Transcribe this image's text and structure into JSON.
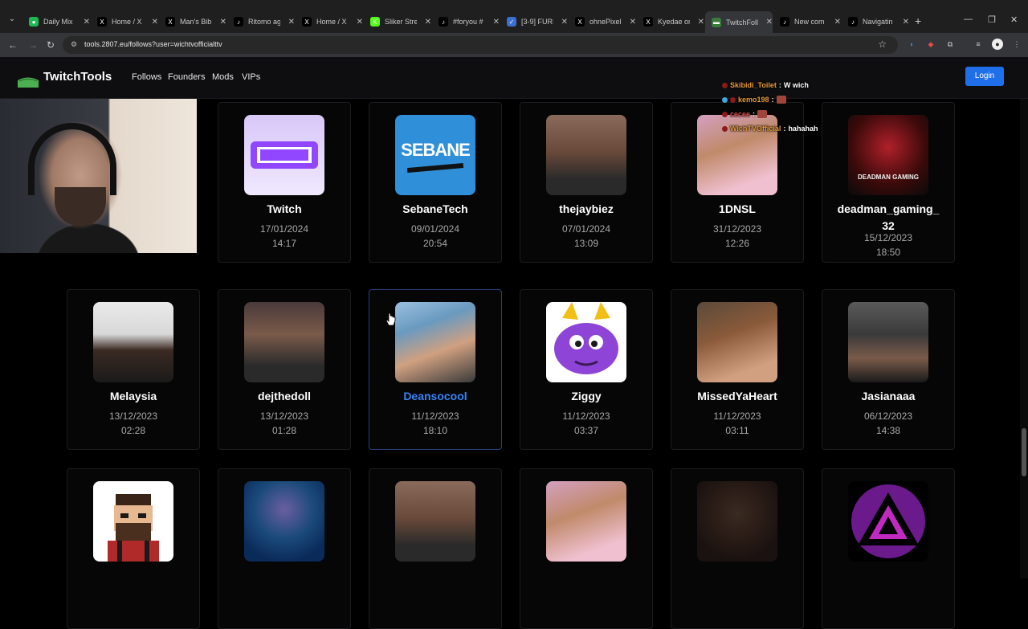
{
  "browser": {
    "tabs": [
      {
        "title": "Daily Mix",
        "color": "#1db954",
        "glyph": "●"
      },
      {
        "title": "Home / X",
        "color": "#000000",
        "glyph": "X"
      },
      {
        "title": "Man's Bib",
        "color": "#000000",
        "glyph": "X"
      },
      {
        "title": "Ritomo ag",
        "color": "#000000",
        "glyph": "♪"
      },
      {
        "title": "Home / X",
        "color": "#000000",
        "glyph": "X"
      },
      {
        "title": "Sliker Stre",
        "color": "#53fc18",
        "glyph": "K"
      },
      {
        "title": "#foryou #",
        "color": "#000000",
        "glyph": "♪"
      },
      {
        "title": "[3-9] FURI",
        "color": "#3b6fd1",
        "glyph": "✓"
      },
      {
        "title": "ohnePixel",
        "color": "#000000",
        "glyph": "X"
      },
      {
        "title": "Kyedae on",
        "color": "#000000",
        "glyph": "X"
      },
      {
        "title": "TwitchFoll",
        "color": "#3a7a3a",
        "glyph": "▬"
      },
      {
        "title": "New com",
        "color": "#000000",
        "glyph": "♪"
      },
      {
        "title": "Navigatin",
        "color": "#000000",
        "glyph": "♪"
      }
    ],
    "active_tab": 10,
    "url": "tools.2807.eu/follows?user=wichtvofficialttv"
  },
  "site": {
    "brand": "TwitchTools",
    "nav": [
      "Follows",
      "Founders",
      "Mods",
      "VIPs"
    ],
    "login": "Login"
  },
  "chat": [
    {
      "user": "Skibidi_Toilet",
      "user_color": "#e89b3a",
      "message": "W wich",
      "emote": false
    },
    {
      "user": "kemo198",
      "user_color": "#e89b3a",
      "message": "",
      "emote": true
    },
    {
      "user": "cecee",
      "user_color": "#e24a4a",
      "message": "",
      "emote": true
    },
    {
      "user": "WichTVOfficial",
      "user_color": "#e89b3a",
      "message": "hahahah",
      "emote": false
    }
  ],
  "follows": [
    {
      "name": "Twitch",
      "date": "17/01/2024",
      "time": "14:17",
      "avatar": "twitch-logo"
    },
    {
      "name": "SebaneTech",
      "date": "09/01/2024",
      "time": "20:54",
      "avatar": "sebane-logo",
      "logo_text": "SEBANE"
    },
    {
      "name": "thejaybiez",
      "date": "07/01/2024",
      "time": "13:09",
      "avatar": "photo"
    },
    {
      "name": "1DNSL",
      "date": "31/12/2023",
      "time": "12:26",
      "avatar": "photo"
    },
    {
      "name": "deadman_gaming_32",
      "date": "15/12/2023",
      "time": "18:50",
      "avatar": "deadman-logo",
      "logo_text": "DEADMAN GAMING"
    },
    {
      "name": "Melaysia",
      "date": "13/12/2023",
      "time": "02:28",
      "avatar": "photo"
    },
    {
      "name": "dejthedoll",
      "date": "13/12/2023",
      "time": "01:28",
      "avatar": "photo"
    },
    {
      "name": "Deansocool",
      "date": "11/12/2023",
      "time": "18:10",
      "avatar": "photo"
    },
    {
      "name": "Ziggy",
      "date": "11/12/2023",
      "time": "03:37",
      "avatar": "spyro-character"
    },
    {
      "name": "MissedYaHeart",
      "date": "11/12/2023",
      "time": "03:11",
      "avatar": "photo"
    },
    {
      "name": "Jasianaaa",
      "date": "06/12/2023",
      "time": "14:38",
      "avatar": "photo"
    },
    {
      "name": "",
      "date": "",
      "time": "",
      "avatar": "pixel-art-character"
    },
    {
      "name": "",
      "date": "",
      "time": "",
      "avatar": "photo"
    },
    {
      "name": "",
      "date": "",
      "time": "",
      "avatar": "photo"
    },
    {
      "name": "",
      "date": "",
      "time": "",
      "avatar": "photo"
    },
    {
      "name": "",
      "date": "",
      "time": "",
      "avatar": "photo"
    },
    {
      "name": "",
      "date": "",
      "time": "",
      "avatar": "triangle-logo"
    }
  ],
  "colors": {
    "accent": "#1f6feb",
    "hover_name": "#3b82f6",
    "page_bg": "#000000",
    "card_bg": "#060606"
  }
}
